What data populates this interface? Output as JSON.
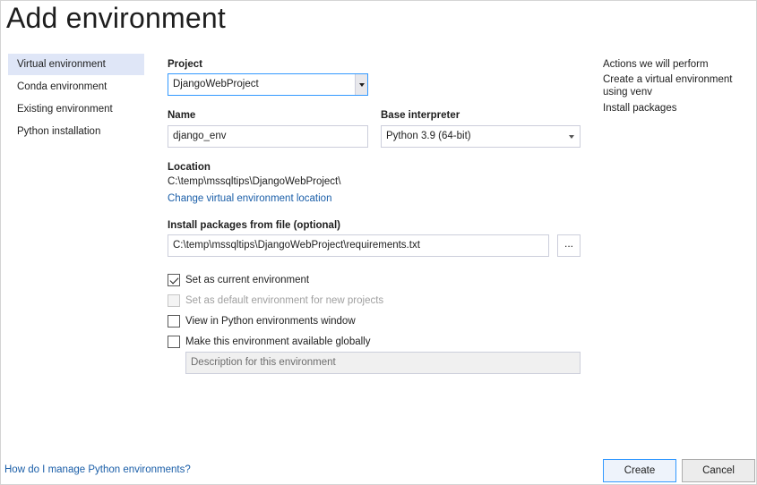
{
  "dialog": {
    "title": "Add environment"
  },
  "sidebar": {
    "items": [
      {
        "label": "Virtual environment",
        "selected": true
      },
      {
        "label": "Conda environment",
        "selected": false
      },
      {
        "label": "Existing environment",
        "selected": false
      },
      {
        "label": "Python installation",
        "selected": false
      }
    ]
  },
  "form": {
    "project_label": "Project",
    "project_value": "DjangoWebProject",
    "name_label": "Name",
    "name_value": "django_env",
    "base_interpreter_label": "Base interpreter",
    "base_interpreter_value": "Python 3.9 (64-bit)",
    "location_label": "Location",
    "location_value": "C:\\temp\\mssqltips\\DjangoWebProject\\",
    "change_location_link": "Change virtual environment location",
    "install_packages_label": "Install packages from file (optional)",
    "install_packages_value": "C:\\temp\\mssqltips\\DjangoWebProject\\requirements.txt",
    "browse_label": "...",
    "checkboxes": [
      {
        "label": "Set as current environment",
        "checked": true,
        "disabled": false
      },
      {
        "label": "Set as default environment for new projects",
        "checked": false,
        "disabled": true
      },
      {
        "label": "View in Python environments window",
        "checked": false,
        "disabled": false
      },
      {
        "label": "Make this environment available globally",
        "checked": false,
        "disabled": false
      }
    ],
    "description_placeholder": "Description for this environment"
  },
  "actions_panel": {
    "title": "Actions we will perform",
    "items": [
      "Create a virtual environment using venv",
      "Install packages"
    ]
  },
  "footer": {
    "help_link": "How do I manage Python environments?",
    "create_label": "Create",
    "cancel_label": "Cancel"
  },
  "colors": {
    "accent": "#3399ff",
    "link": "#1a5ea8",
    "selected_nav": "#dfe6f7"
  }
}
